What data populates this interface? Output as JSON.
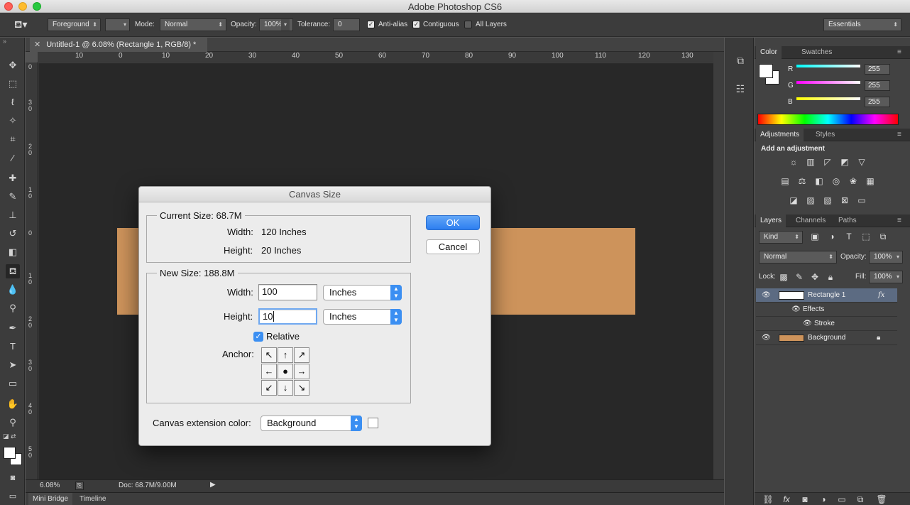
{
  "window": {
    "title": "Adobe Photoshop CS6"
  },
  "colors": {
    "close": "#fe5f57",
    "minimize": "#febc2e",
    "zoom": "#28c840",
    "accent": "#3b8ff2",
    "layer_bg": "#cd935b"
  },
  "options_bar": {
    "fill_source": "Foreground",
    "mode_label": "Mode:",
    "mode_value": "Normal",
    "opacity_label": "Opacity:",
    "opacity_value": "100%",
    "tolerance_label": "Tolerance:",
    "tolerance_value": "0",
    "anti_alias": "Anti-alias",
    "contiguous": "Contiguous",
    "all_layers": "All Layers",
    "workspace": "Essentials"
  },
  "document": {
    "tab_title": "Untitled-1 @ 6.08% (Rectangle 1, RGB/8) *",
    "zoom": "6.08%",
    "doc_info": "Doc: 68.7M/9.00M"
  },
  "ruler_top": [
    "10",
    "0",
    "10",
    "20",
    "30",
    "40",
    "50",
    "60",
    "70",
    "80",
    "90",
    "100",
    "110",
    "120",
    "130"
  ],
  "ruler_left": [
    "0",
    "3 0",
    "2 0",
    "1 0",
    "0",
    "1 0",
    "2 0",
    "3 0",
    "4 0",
    "5 0"
  ],
  "bottom_tabs": [
    "Mini Bridge",
    "Timeline"
  ],
  "color_panel": {
    "tabs": [
      "Color",
      "Swatches"
    ],
    "channels": [
      {
        "name": "R",
        "value": "255"
      },
      {
        "name": "G",
        "value": "255"
      },
      {
        "name": "B",
        "value": "255"
      }
    ]
  },
  "adjustments_panel": {
    "tabs": [
      "Adjustments",
      "Styles"
    ],
    "heading": "Add an adjustment"
  },
  "layers_panel": {
    "tabs": [
      "Layers",
      "Channels",
      "Paths"
    ],
    "filter": "Kind",
    "blend_mode": "Normal",
    "opacity_label": "Opacity:",
    "opacity_value": "100%",
    "lock_label": "Lock:",
    "fill_label": "Fill:",
    "fill_value": "100%",
    "layers": [
      {
        "name": "Rectangle 1",
        "fx": "fx"
      },
      {
        "name": "Effects"
      },
      {
        "name": "Stroke"
      },
      {
        "name": "Background"
      }
    ]
  },
  "dialog": {
    "title": "Canvas Size",
    "current_size_label": "Current Size: 68.7M",
    "current_width_label": "Width:",
    "current_width_value": "120 Inches",
    "current_height_label": "Height:",
    "current_height_value": "20 Inches",
    "new_size_label": "New Size: 188.8M",
    "width_label": "Width:",
    "width_value": "100",
    "width_unit": "Inches",
    "height_label": "Height:",
    "height_value": "10",
    "height_unit": "Inches",
    "relative_label": "Relative",
    "relative_checked": true,
    "anchor_label": "Anchor:",
    "extension_label": "Canvas extension color:",
    "extension_value": "Background",
    "ok_label": "OK",
    "cancel_label": "Cancel"
  }
}
